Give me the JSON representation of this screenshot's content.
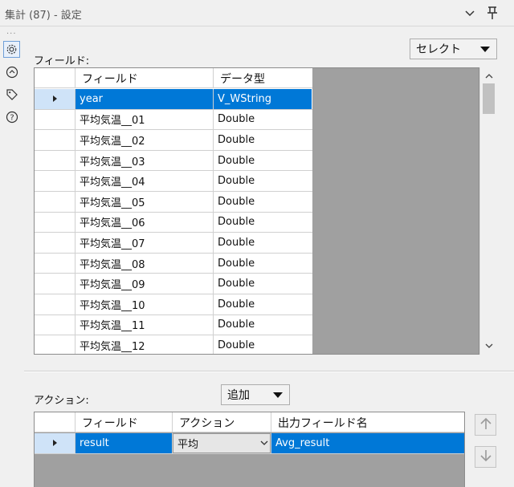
{
  "window": {
    "title": "集計 (87) - 設定",
    "menu_dots": "..."
  },
  "icons": {
    "collapse": "chevron-down-icon",
    "pin": "pin-icon",
    "settings": "gear-icon",
    "rules": "rules-icon",
    "tag": "tag-icon",
    "help": "help-icon"
  },
  "fields_section": {
    "label": "フィールド:",
    "select_button": "セレクト",
    "columns": [
      "フィールド",
      "データ型"
    ],
    "rows": [
      {
        "field": "year",
        "type": "V_WString",
        "selected": true
      },
      {
        "field": "平均気温__01",
        "type": "Double"
      },
      {
        "field": "平均気温__02",
        "type": "Double"
      },
      {
        "field": "平均気温__03",
        "type": "Double"
      },
      {
        "field": "平均気温__04",
        "type": "Double"
      },
      {
        "field": "平均気温__05",
        "type": "Double"
      },
      {
        "field": "平均気温__06",
        "type": "Double"
      },
      {
        "field": "平均気温__07",
        "type": "Double"
      },
      {
        "field": "平均気温__08",
        "type": "Double"
      },
      {
        "field": "平均気温__09",
        "type": "Double"
      },
      {
        "field": "平均気温__10",
        "type": "Double"
      },
      {
        "field": "平均気温__11",
        "type": "Double"
      },
      {
        "field": "平均気温__12",
        "type": "Double"
      }
    ]
  },
  "actions_section": {
    "label": "アクション:",
    "add_button": "追加",
    "columns": [
      "フィールド",
      "アクション",
      "出力フィールド名"
    ],
    "rows": [
      {
        "field": "result",
        "action": "平均",
        "output": "Avg_result",
        "selected": true
      }
    ]
  },
  "colors": {
    "selection": "#0078d7",
    "grid_background": "#a0a0a0"
  }
}
